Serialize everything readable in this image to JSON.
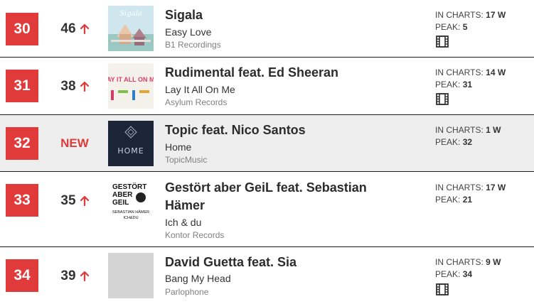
{
  "labels": {
    "in_charts": "IN CHARTS:",
    "peak": "PEAK:"
  },
  "accent_color": "#e03a3a",
  "entries": [
    {
      "rank": "30",
      "previous": "46",
      "movement": "up",
      "artist": "Sigala",
      "title": "Easy Love",
      "label": "B1 Recordings",
      "weeks": "17 W",
      "peak": "5",
      "video": true,
      "cover": "sigala-cover",
      "cover_text": "Sigala"
    },
    {
      "rank": "31",
      "previous": "38",
      "movement": "up",
      "artist": "Rudimental feat. Ed Sheeran",
      "title": "Lay It All On Me",
      "label": "Asylum Records",
      "weeks": "14 W",
      "peak": "31",
      "video": true,
      "cover": "layitallonme-cover",
      "cover_text": "LAY IT ALL ON ME"
    },
    {
      "rank": "32",
      "previous": "NEW",
      "movement": "new",
      "artist": "Topic feat. Nico Santos",
      "title": "Home",
      "label": "TopicMusic",
      "weeks": "1 W",
      "peak": "32",
      "video": false,
      "cover": "home-cover",
      "cover_text": "HOME"
    },
    {
      "rank": "33",
      "previous": "35",
      "movement": "up",
      "artist": "Gestört aber GeiL feat. Sebastian Hämer",
      "title": "Ich & du",
      "label": "Kontor Records",
      "weeks": "17 W",
      "peak": "21",
      "video": false,
      "cover": "gestort-cover",
      "cover_text": [
        "GESTÖRT",
        "ABER",
        "GEIL",
        "SEBASTIAN HÄMER",
        "ICH&DU"
      ]
    },
    {
      "rank": "34",
      "previous": "39",
      "movement": "up",
      "artist": "David Guetta feat. Sia",
      "title": "Bang My Head",
      "label": "Parlophone",
      "weeks": "9 W",
      "peak": "34",
      "video": true,
      "cover": "placeholder-cover"
    }
  ]
}
